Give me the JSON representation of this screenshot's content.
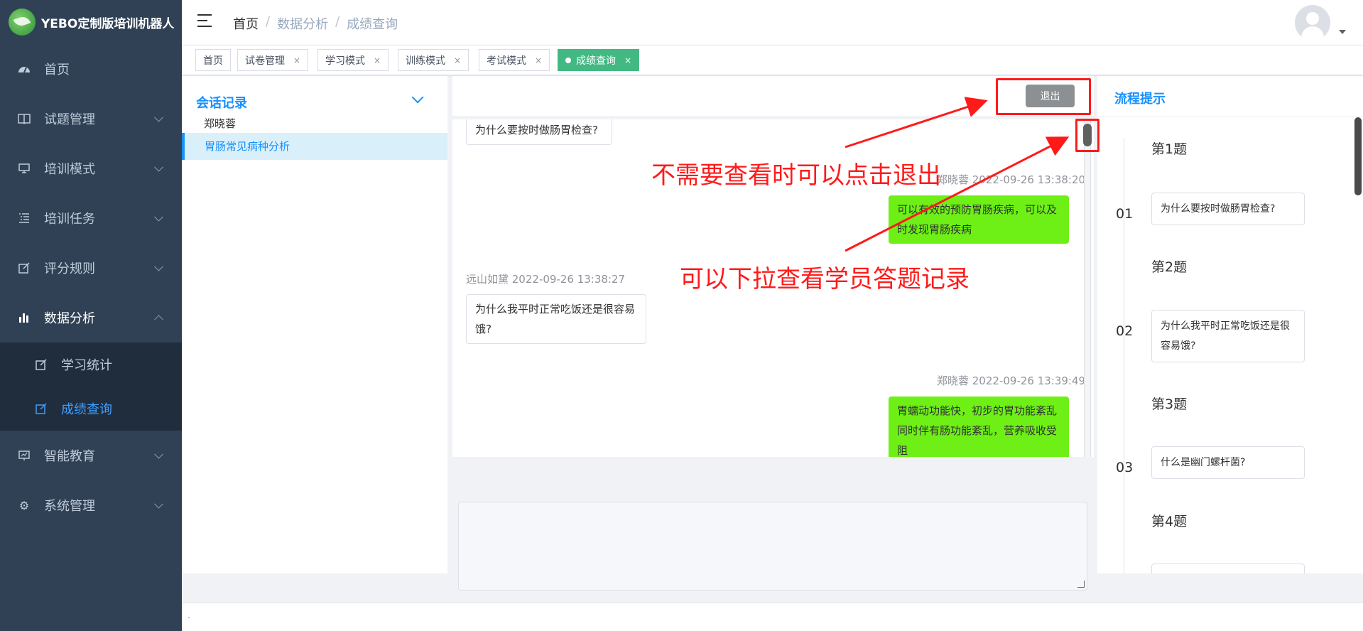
{
  "app": {
    "logo_text": "YEBO定制版培训机器人"
  },
  "sidebar": {
    "items": [
      {
        "label": "首页",
        "icon": "dashboard-icon"
      },
      {
        "label": "试题管理",
        "icon": "book-icon"
      },
      {
        "label": "培训模式",
        "icon": "monitor-icon"
      },
      {
        "label": "培训任务",
        "icon": "list-icon"
      },
      {
        "label": "评分规则",
        "icon": "edit-icon"
      },
      {
        "label": "数据分析",
        "icon": "chart-icon"
      },
      {
        "label": "智能教育",
        "icon": "presentation-icon"
      },
      {
        "label": "系统管理",
        "icon": "gear-icon"
      }
    ],
    "sub_items": [
      {
        "label": "学习统计",
        "icon": "edit-icon"
      },
      {
        "label": "成绩查询",
        "icon": "edit-icon"
      }
    ]
  },
  "header": {
    "breadcrumb": [
      "首页",
      "数据分析",
      "成绩查询"
    ]
  },
  "tags": [
    {
      "label": "首页"
    },
    {
      "label": "试卷管理",
      "close": "×"
    },
    {
      "label": "学习模式",
      "close": "×"
    },
    {
      "label": "训练模式",
      "close": "×"
    },
    {
      "label": "考试模式",
      "close": "×"
    },
    {
      "label": "成绩查询",
      "close": "×"
    }
  ],
  "session": {
    "title": "会话记录",
    "user": "郑晓蓉",
    "item": "胃肠常见病种分析"
  },
  "chat": {
    "exit_label": "退出",
    "messages": [
      {
        "side": "left",
        "text": "为什么要按时做肠胃检查?"
      },
      {
        "side": "right",
        "meta": "郑晓蓉 2022-09-26 13:38:20",
        "text": "可以有效的预防胃肠疾病，可以及时发现胃肠疾病"
      },
      {
        "side": "left",
        "meta": "远山如黛 2022-09-26 13:38:27",
        "text": "为什么我平时正常吃饭还是很容易饿?"
      },
      {
        "side": "right",
        "meta": "郑晓蓉 2022-09-26 13:39:49",
        "text": "胃蠕动功能快，初步的胃功能紊乱同时伴有肠功能紊乱，营养吸收受阻"
      }
    ]
  },
  "process": {
    "title": "流程提示",
    "steps": [
      {
        "title": "第1题",
        "num": "01",
        "question": "为什么要按时做肠胃检查?"
      },
      {
        "title": "第2题",
        "num": "02",
        "question": "为什么我平时正常吃饭还是很容易饿?"
      },
      {
        "title": "第3题",
        "num": "03",
        "question": "什么是幽门螺杆菌?"
      },
      {
        "title": "第4题"
      }
    ]
  },
  "annotations": {
    "exit_hint": "不需要查看时可以点击退出",
    "scroll_hint": "可以下拉查看学员答题记录"
  },
  "footer": {
    "text": "."
  },
  "colors": {
    "sidebar_bg": "#304156",
    "accent": "#1890ff",
    "tag_active": "#42b983",
    "bubble_green": "#6ef016",
    "annotation": "#ff1a1a"
  }
}
